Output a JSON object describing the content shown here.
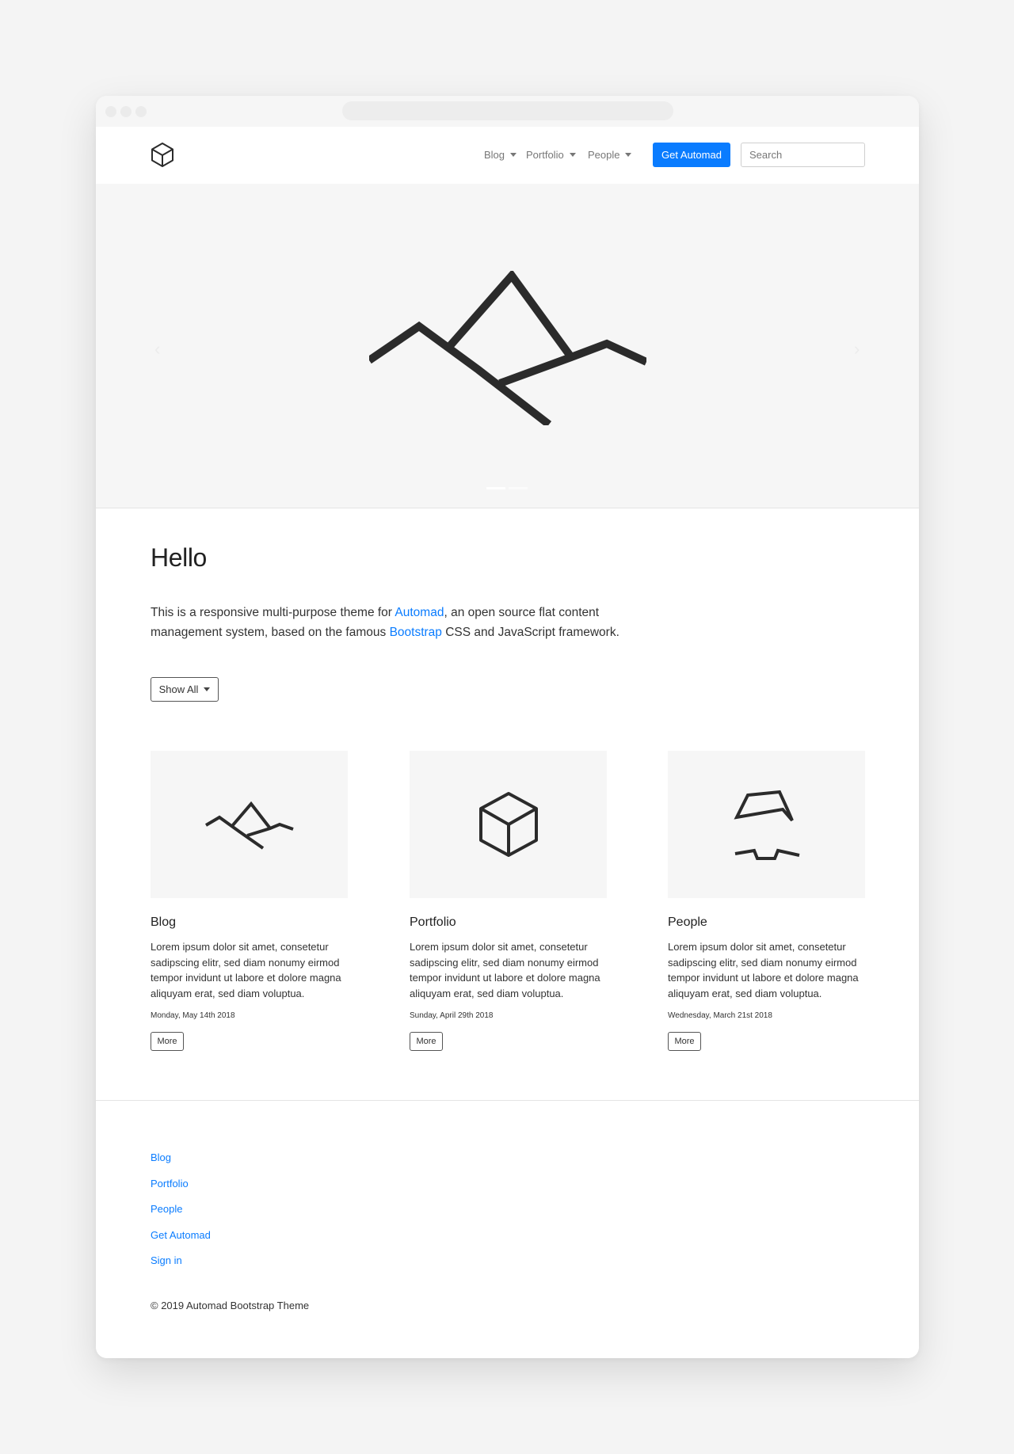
{
  "nav": {
    "logo_icon": "cube-outline-icon",
    "items": [
      {
        "label": "Blog"
      },
      {
        "label": "Portfolio"
      },
      {
        "label": "People"
      }
    ],
    "cta_label": "Get Automad",
    "search_placeholder": "Search"
  },
  "hero": {
    "image_icon": "mountain-line-icon",
    "prev_icon": "chevron-left-icon",
    "next_icon": "chevron-right-icon",
    "slide_count": 2,
    "active_slide": 1
  },
  "intro": {
    "title": "Hello",
    "text_before": "This is a responsive multi-purpose theme for ",
    "link1": "Automad",
    "text_middle": ", an open source flat content management system, based on the famous ",
    "link2": "Bootstrap",
    "text_after": " CSS and JavaScript framework."
  },
  "filter": {
    "label": "Show All"
  },
  "cards": [
    {
      "icon": "mountain-line-icon",
      "title": "Blog",
      "text": "Lorem ipsum dolor sit amet, consetetur sadipscing elitr, sed diam nonumy eirmod tempor invidunt ut labore et dolore magna aliquyam erat, sed diam voluptua.",
      "date": "Monday, May 14th 2018",
      "button": "More"
    },
    {
      "icon": "cube-outline-icon",
      "title": "Portfolio",
      "text": "Lorem ipsum dolor sit amet, consetetur sadipscing elitr, sed diam nonumy eirmod tempor invidunt ut labore et dolore magna aliquyam erat, sed diam voluptua.",
      "date": "Sunday, April 29th 2018",
      "button": "More"
    },
    {
      "icon": "person-hat-mustache-icon",
      "title": "People",
      "text": "Lorem ipsum dolor sit amet, consetetur sadipscing elitr, sed diam nonumy eirmod tempor invidunt ut labore et dolore magna aliquyam erat, sed diam voluptua.",
      "date": "Wednesday, March 21st 2018",
      "button": "More"
    }
  ],
  "footer": {
    "links": [
      {
        "label": "Blog"
      },
      {
        "label": "Portfolio"
      },
      {
        "label": "People"
      },
      {
        "label": "Get Automad"
      },
      {
        "label": "Sign in"
      }
    ],
    "copyright": "© 2019 Automad Bootstrap Theme"
  },
  "colors": {
    "accent": "#0a7cff",
    "page_background": "#f4f4f4",
    "hero_background": "#f6f6f6",
    "icon_stroke": "#2b2b2b"
  }
}
